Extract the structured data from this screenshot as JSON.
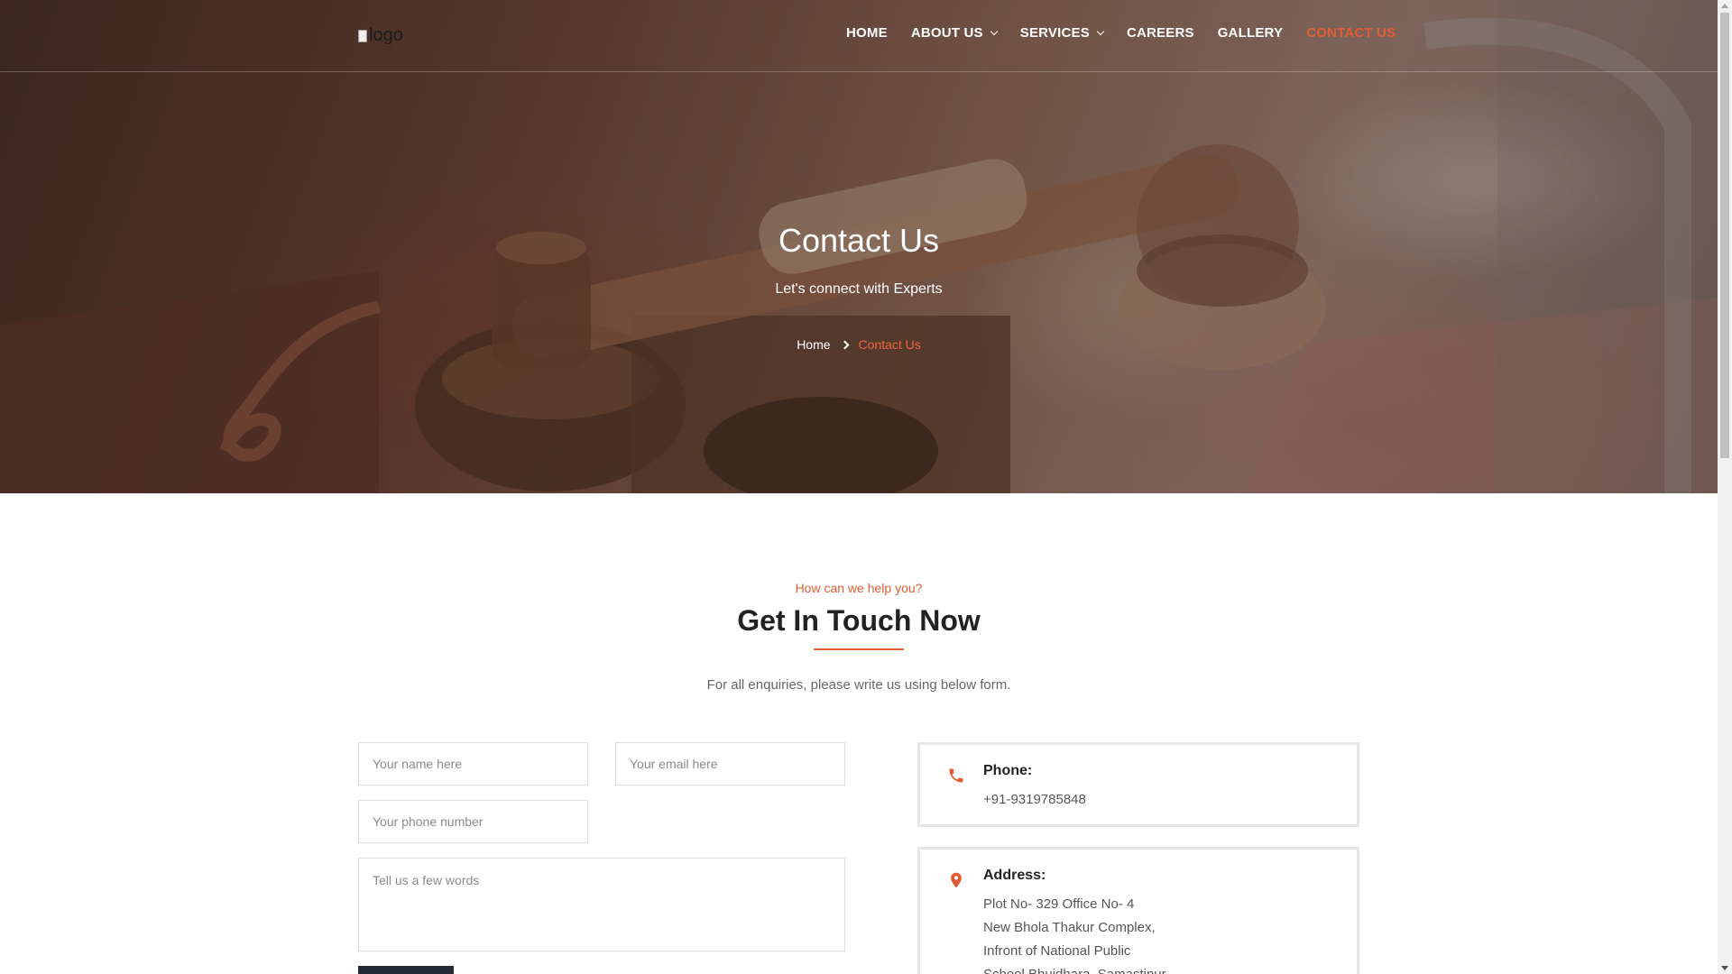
{
  "header": {
    "logo_alt": "logo",
    "nav": {
      "home": "HOME",
      "about": "ABOUT US",
      "services": "SERVICES",
      "careers": "CAREERS",
      "gallery": "GALLERY",
      "contact": "CONTACT US"
    },
    "active_item": "CONTACT US"
  },
  "hero": {
    "title": "Contact Us",
    "subtitle": "Let's connect with Experts",
    "breadcrumb": {
      "home": "Home",
      "current": "Contact Us"
    }
  },
  "section": {
    "eyebrow": "How can we help you?",
    "title": "Get In Touch Now",
    "intro": "For all enquiries, please write us using below form."
  },
  "form": {
    "name_placeholder": "Your name here",
    "email_placeholder": "Your email here",
    "phone_placeholder": "Your phone number",
    "message_placeholder": "Tell us a few words"
  },
  "contact_info": {
    "phone": {
      "label": "Phone:",
      "value": "+91-9319785848",
      "icon": "phone-icon"
    },
    "address": {
      "label": "Address:",
      "icon": "location-pin-icon",
      "lines": [
        "Plot No- 329 Office No- 4",
        "New Bhola Thakur Complex,",
        "Infront of National Public",
        "School Bhuidhara, Samastipur"
      ]
    }
  },
  "colors": {
    "accent": "#e15b33",
    "heading": "#222222",
    "body_text": "#666666",
    "card_border": "#e6e6e6",
    "button_bg": "#222a35"
  }
}
